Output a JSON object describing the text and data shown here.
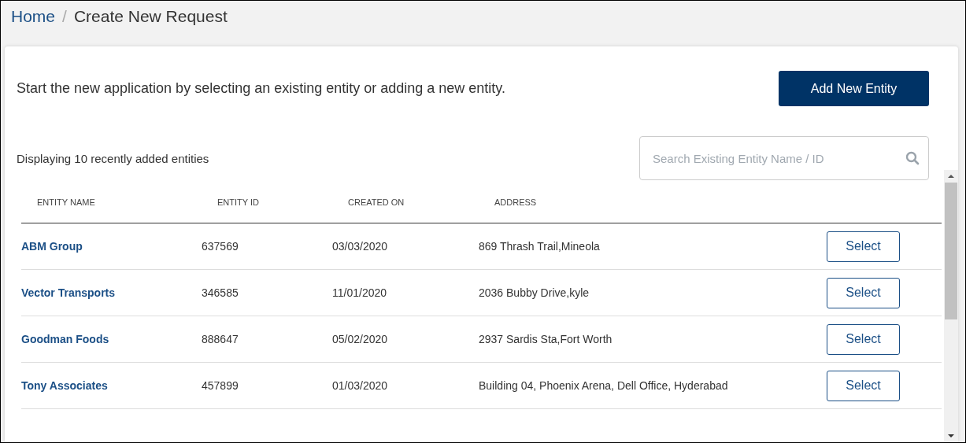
{
  "breadcrumb": {
    "home": "Home",
    "separator": "/",
    "current": "Create New Request"
  },
  "intro": "Start the new application by selecting an existing entity or adding a new entity.",
  "add_button": "Add New Entity",
  "count_label": "Displaying 10 recently added entities",
  "search": {
    "placeholder": "Search Existing Entity Name / ID"
  },
  "table": {
    "columns": [
      "ENTITY NAME",
      "ENTITY ID",
      "CREATED ON",
      "ADDRESS"
    ],
    "rows": [
      {
        "name": "ABM Group",
        "id": "637569",
        "created": "03/03/2020",
        "address": "869 Thrash Trail,Mineola",
        "action": "Select"
      },
      {
        "name": "Vector Transports",
        "id": "346585",
        "created": "11/01/2020",
        "address": "2036 Bubby Drive,kyle",
        "action": "Select"
      },
      {
        "name": "Goodman Foods",
        "id": "888647",
        "created": "05/02/2020",
        "address": "2937 Sardis Sta,Fort Worth",
        "action": "Select"
      },
      {
        "name": "Tony Associates",
        "id": "457899",
        "created": "01/03/2020",
        "address": "Building 04, Phoenix Arena, Dell Office, Hyderabad",
        "action": "Select"
      }
    ]
  }
}
